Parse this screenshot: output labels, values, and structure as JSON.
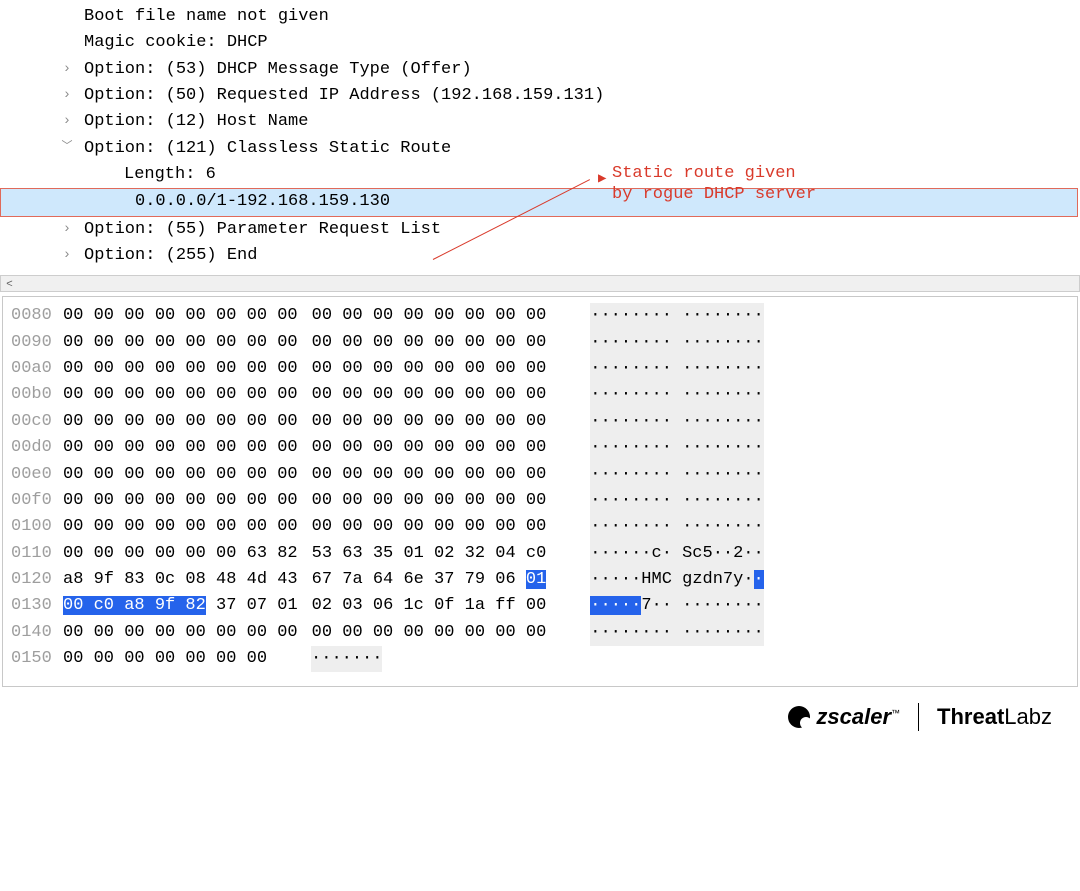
{
  "tree": {
    "boot_file": "Boot file name not given",
    "magic_cookie": "Magic cookie: DHCP",
    "opt53": "Option: (53) DHCP Message Type (Offer)",
    "opt50": "Option: (50) Requested IP Address (192.168.159.131)",
    "opt12": "Option: (12) Host Name",
    "opt121": "Option: (121) Classless Static Route",
    "opt121_len": "Length: 6",
    "opt121_route": "0.0.0.0/1-192.168.159.130",
    "opt55": "Option: (55) Parameter Request List",
    "opt255": "Option: (255) End"
  },
  "annotation": {
    "line1": "Static route given",
    "line2": "by rogue DHCP server"
  },
  "hex": {
    "rows": [
      {
        "off": "0080",
        "g1": "00 00 00 00 00 00 00 00",
        "g2": "00 00 00 00 00 00 00 00",
        "ascii": "········ ········"
      },
      {
        "off": "0090",
        "g1": "00 00 00 00 00 00 00 00",
        "g2": "00 00 00 00 00 00 00 00",
        "ascii": "········ ········"
      },
      {
        "off": "00a0",
        "g1": "00 00 00 00 00 00 00 00",
        "g2": "00 00 00 00 00 00 00 00",
        "ascii": "········ ········"
      },
      {
        "off": "00b0",
        "g1": "00 00 00 00 00 00 00 00",
        "g2": "00 00 00 00 00 00 00 00",
        "ascii": "········ ········"
      },
      {
        "off": "00c0",
        "g1": "00 00 00 00 00 00 00 00",
        "g2": "00 00 00 00 00 00 00 00",
        "ascii": "········ ········"
      },
      {
        "off": "00d0",
        "g1": "00 00 00 00 00 00 00 00",
        "g2": "00 00 00 00 00 00 00 00",
        "ascii": "········ ········"
      },
      {
        "off": "00e0",
        "g1": "00 00 00 00 00 00 00 00",
        "g2": "00 00 00 00 00 00 00 00",
        "ascii": "········ ········"
      },
      {
        "off": "00f0",
        "g1": "00 00 00 00 00 00 00 00",
        "g2": "00 00 00 00 00 00 00 00",
        "ascii": "········ ········"
      },
      {
        "off": "0100",
        "g1": "00 00 00 00 00 00 00 00",
        "g2": "00 00 00 00 00 00 00 00",
        "ascii": "········ ········"
      },
      {
        "off": "0110",
        "g1": "00 00 00 00 00 00 63 82",
        "g2": "53 63 35 01 02 32 04 c0",
        "ascii": "······c· Sc5··2··"
      },
      {
        "off": "0140",
        "g1": "00 00 00 00 00 00 00 00",
        "g2": "00 00 00 00 00 00 00 00",
        "ascii": "········ ········"
      },
      {
        "off": "0150",
        "g1": "00 00 00 00 00 00 00",
        "g2": "",
        "ascii": "·······"
      }
    ],
    "row0120": {
      "off": "0120",
      "pre": "a8 9f 83 0c 08 48 4d 43",
      "g2a": "67 7a 64 6e 37 79 06 ",
      "g2sel": "01",
      "ascii_pre": "·····HMC gzdn7y·",
      "ascii_sel": "·"
    },
    "row0130": {
      "off": "0130",
      "sel": "00 c0 a8 9f 82",
      "post": " 37 07 01",
      "g2": "02 03 06 1c 0f 1a ff 00",
      "ascii_sel": "·····",
      "ascii_post": "7·· ········"
    }
  },
  "footer": {
    "brand1": "zscaler",
    "brand2a": "Threat",
    "brand2b": "Labz"
  }
}
